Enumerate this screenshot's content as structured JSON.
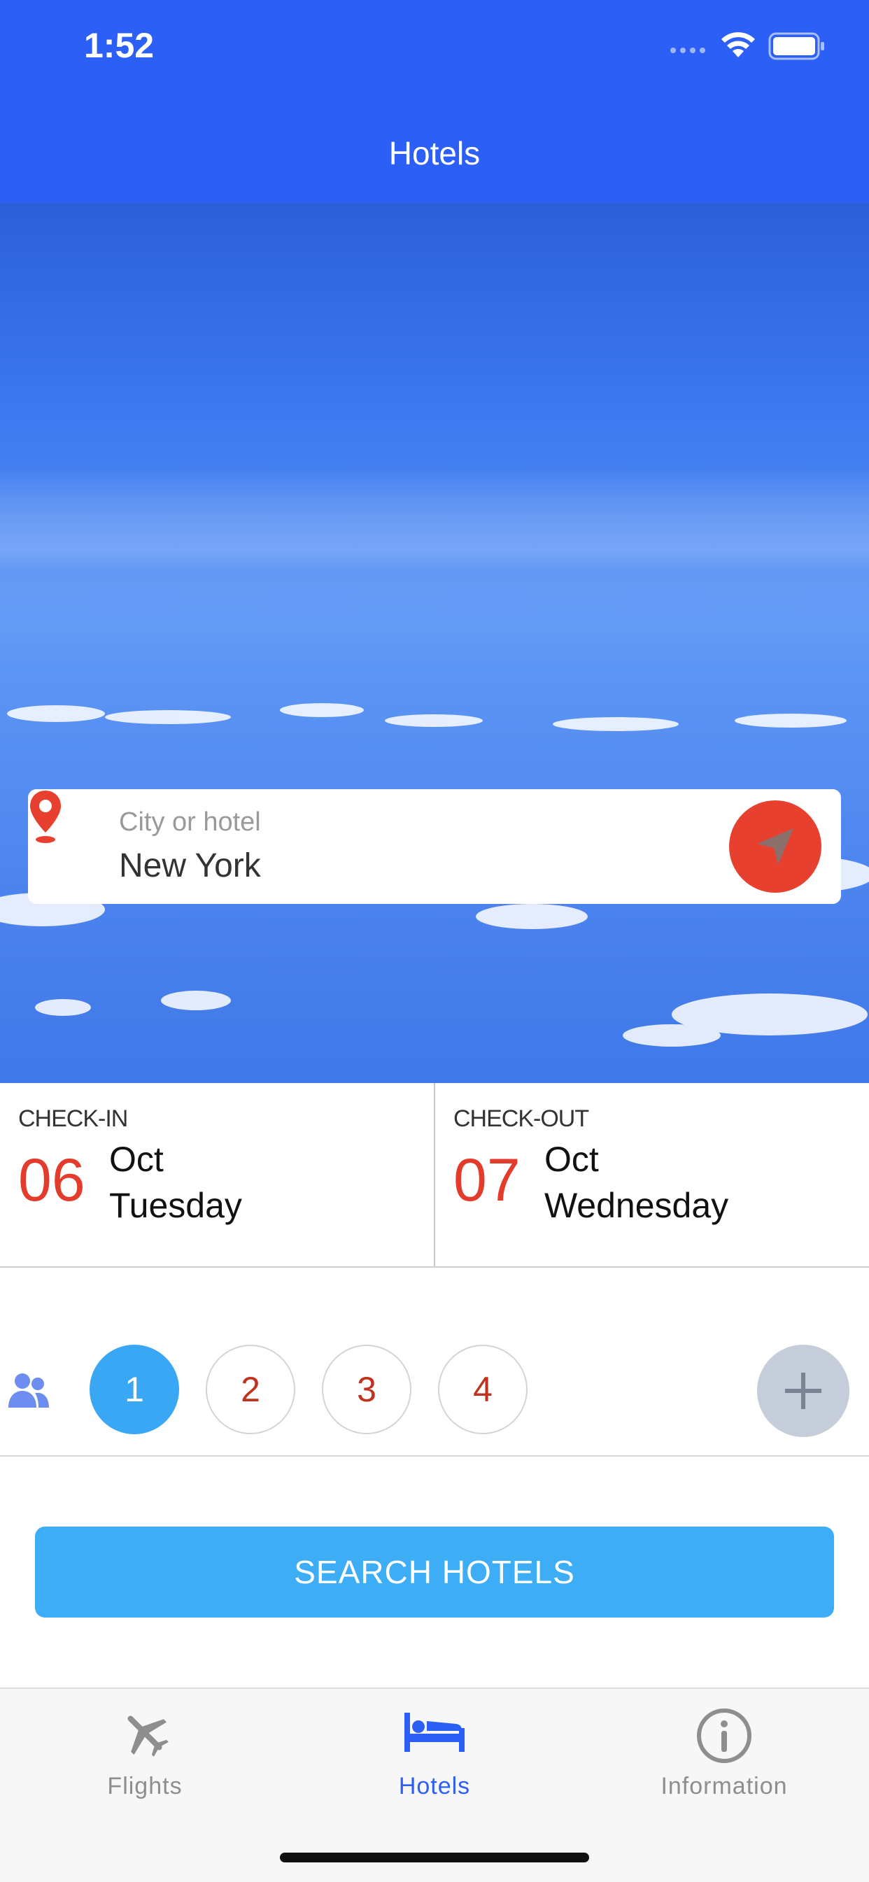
{
  "status_bar": {
    "time": "1:52"
  },
  "nav": {
    "title": "Hotels"
  },
  "search": {
    "label": "City or hotel",
    "value": "New York"
  },
  "checkin": {
    "label": "CHECK-IN",
    "day": "06",
    "month": "Oct",
    "weekday": "Tuesday"
  },
  "checkout": {
    "label": "CHECK-OUT",
    "day": "07",
    "month": "Oct",
    "weekday": "Wednesday"
  },
  "guests": {
    "options": [
      "1",
      "2",
      "3",
      "4"
    ],
    "selected": "1"
  },
  "search_button": {
    "label": "SEARCH HOTELS"
  },
  "tabbar": {
    "tabs": [
      {
        "label": "Flights",
        "icon": "airplane-icon"
      },
      {
        "label": "Hotels",
        "icon": "bed-icon"
      },
      {
        "label": "Information",
        "icon": "info-icon"
      }
    ],
    "active": "Hotels"
  },
  "colors": {
    "header": "#2c5ff6",
    "accent_red": "#e43c2c",
    "button_blue": "#3daef5",
    "selected_guest": "#3aa7f5",
    "active_tab": "#2c5ff6"
  }
}
